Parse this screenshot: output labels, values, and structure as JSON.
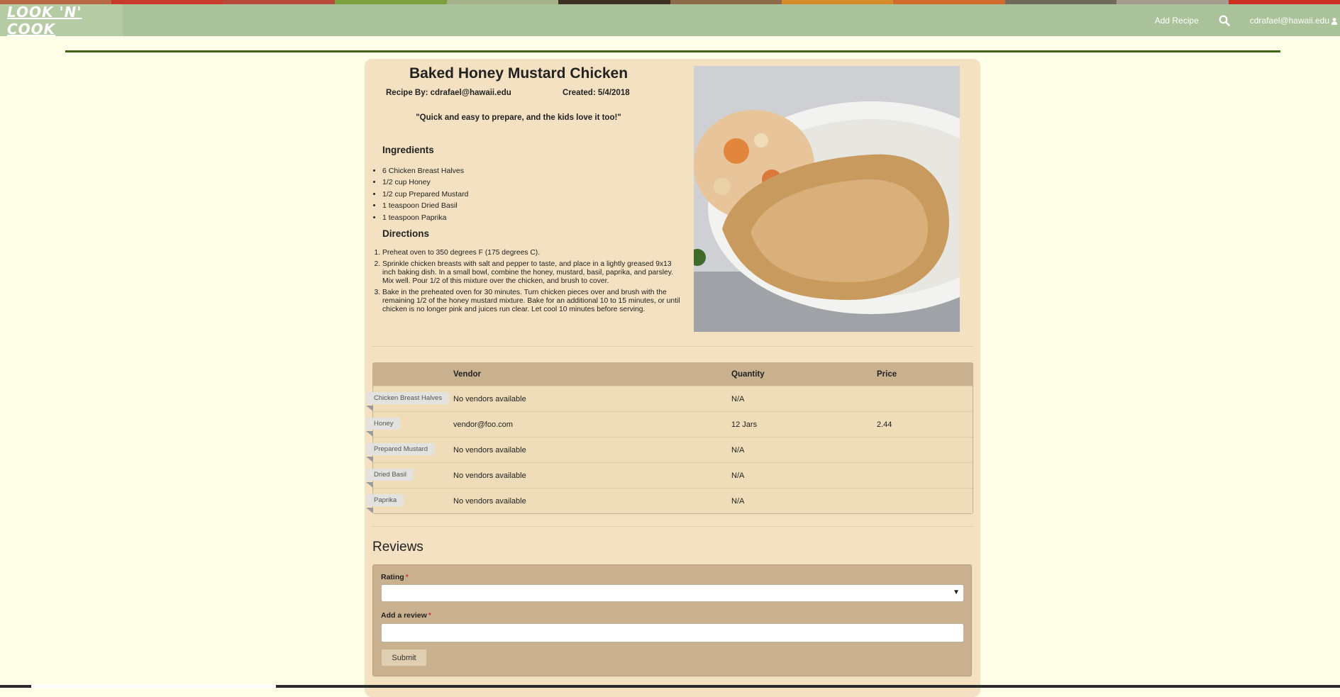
{
  "app": {
    "logo_text": "LOOK 'N' COOK"
  },
  "nav": {
    "add_recipe": "Add Recipe",
    "search_icon": "search-icon",
    "user_email": "cdrafael@hawaii.edu",
    "user_icon": "user-icon"
  },
  "recipe": {
    "title": "Baked Honey Mustard Chicken",
    "recipe_by": "Recipe By: cdrafael@hawaii.edu",
    "created": "Created: 5/4/2018",
    "quote": "\"Quick and easy to prepare, and the kids love it too!\"",
    "ingredients_heading": "Ingredients",
    "ingredients": [
      "6 Chicken Breast Halves",
      "1/2 cup Honey",
      "1/2 cup Prepared Mustard",
      "1 teaspoon Dried Basil",
      "1 teaspoon Paprika"
    ],
    "directions_heading": "Directions",
    "directions": [
      "Preheat oven to 350 degrees F (175 degrees C).",
      "Sprinkle chicken breasts with salt and pepper to taste, and place in a lightly greased 9x13 inch baking dish. In a small bowl, combine the honey, mustard, basil, paprika, and parsley. Mix well. Pour 1/2 of this mixture over the chicken, and brush to cover.",
      "Bake in the preheated oven for 30 minutes. Turn chicken pieces over and brush with the remaining 1/2 of the honey mustard mixture. Bake for an additional 10 to 15 minutes, or until chicken is no longer pink and juices run clear. Let cool 10 minutes before serving."
    ]
  },
  "vendors": {
    "headers": [
      "",
      "Vendor",
      "Quantity",
      "Price"
    ],
    "rows": [
      {
        "ingredient": "Chicken Breast Halves",
        "vendor": "No vendors available",
        "quantity": "N/A",
        "price": ""
      },
      {
        "ingredient": "Honey",
        "vendor": "vendor@foo.com",
        "quantity": "12 Jars",
        "price": "2.44"
      },
      {
        "ingredient": "Prepared Mustard",
        "vendor": "No vendors available",
        "quantity": "N/A",
        "price": ""
      },
      {
        "ingredient": "Dried Basil",
        "vendor": "No vendors available",
        "quantity": "N/A",
        "price": ""
      },
      {
        "ingredient": "Paprika",
        "vendor": "No vendors available",
        "quantity": "N/A",
        "price": ""
      }
    ]
  },
  "reviews": {
    "heading": "Reviews",
    "rating_label": "Rating",
    "rating_value": "",
    "review_label": "Add a review",
    "review_value": "",
    "required_mark": "*",
    "submit_label": "Submit"
  },
  "colors": {
    "navbar": "#a9c299",
    "accent_rule": "#3b6512",
    "card": "#f3e1c2",
    "table_header": "#c9b08e",
    "required": "#d0353f"
  }
}
